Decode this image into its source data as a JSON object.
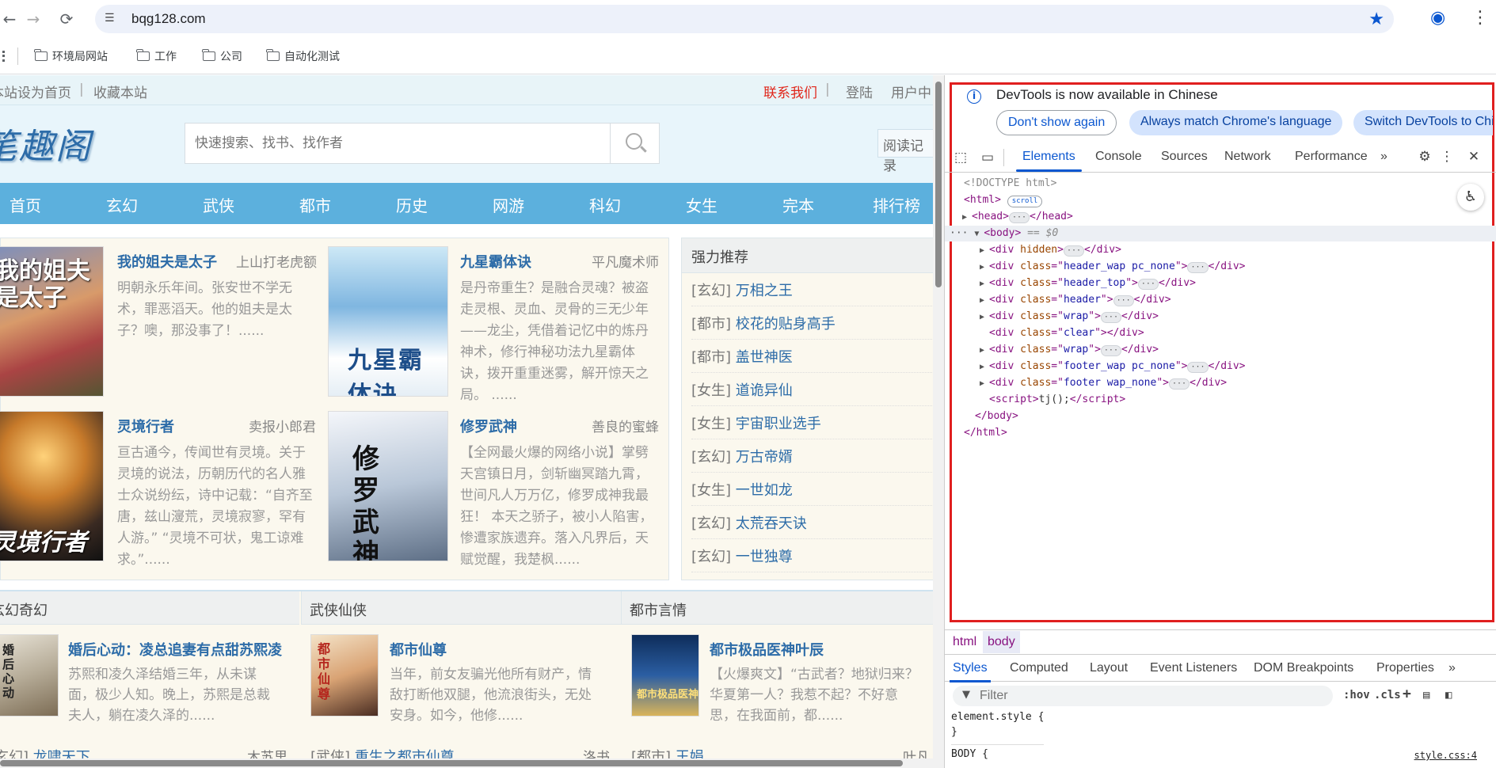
{
  "browser": {
    "url": "bqg128.com",
    "bookmarks": [
      "环境局网站",
      "工作",
      "公司",
      "自动化测试"
    ]
  },
  "site": {
    "topbar": {
      "set_home": "本站设为首页",
      "separator": "|",
      "bookmark_site": "收藏本站",
      "contact": "联系我们",
      "login": "登陆",
      "user_center": "用户中"
    },
    "logo_text": "笔趣阁",
    "search_placeholder": "快速搜索、找书、找作者",
    "reading_history": "阅读记录",
    "menu": [
      "首页",
      "玄幻",
      "武侠",
      "都市",
      "历史",
      "网游",
      "科幻",
      "女生",
      "完本",
      "排行榜"
    ],
    "hot_books": [
      {
        "title": "我的姐夫是太子",
        "author": "上山打老虎额",
        "desc": "明朝永乐年间。张安世不学无术，罪恶滔天。他的姐夫是太子？噢，那没事了！......",
        "cover_text": "我的姐夫是太子"
      },
      {
        "title": "九星霸体诀",
        "author": "平凡魔术师",
        "desc": "是丹帝重生？是融合灵魂？被盗走灵根、灵血、灵骨的三无少年——龙尘，凭借着记忆中的炼丹神术，修行神秘功法九星霸体诀，拨开重重迷雾，解开惊天之局。 ......",
        "cover_text": "九星霸体诀"
      },
      {
        "title": "灵境行者",
        "author": "卖报小郎君",
        "desc": "亘古通今，传闻世有灵境。关于灵境的说法，历朝历代的名人雅士众说纷纭，诗中记载：“自齐至唐，兹山濅荒，灵境寂寥，罕有人游。” “灵境不可状，鬼工谅难求。”......",
        "cover_text": "灵境行者"
      },
      {
        "title": "修罗武神",
        "author": "善良的蜜蜂",
        "desc": "【全网最火爆的网络小说】掌劈天宫镇日月，剑斩幽冥踏九霄，世间凡人万万亿，修罗成神我最狂！ 本天之骄子，被小人陷害，惨遭家族遗弃。落入凡界后，天赋觉醒，我楚枫......",
        "cover_text": "修罗武神"
      }
    ],
    "recommend": {
      "heading": "强力推荐",
      "items": [
        {
          "cat": "[玄幻]",
          "title": "万相之王"
        },
        {
          "cat": "[都市]",
          "title": "校花的贴身高手"
        },
        {
          "cat": "[都市]",
          "title": "盖世神医"
        },
        {
          "cat": "[女生]",
          "title": "道诡异仙"
        },
        {
          "cat": "[女生]",
          "title": "宇宙职业选手"
        },
        {
          "cat": "[玄幻]",
          "title": "万古帝婿"
        },
        {
          "cat": "[女生]",
          "title": "一世如龙"
        },
        {
          "cat": "[玄幻]",
          "title": "太荒吞天诀"
        },
        {
          "cat": "[玄幻]",
          "title": "一世独尊"
        }
      ]
    },
    "sections": [
      {
        "heading": "玄幻奇幻",
        "featured_title": "婚后心动：凌总追妻有点甜苏熙凌",
        "featured_desc": "苏熙和凌久泽结婚三年，从未谋面，极少人知。晚上，苏熙是总裁夫人，躺在凌久泽的......",
        "cover_text": "婚后心动",
        "line_cat": "[玄幻]",
        "line_title": "龙啸天下",
        "line_author": "木苏里"
      },
      {
        "heading": "武侠仙侠",
        "featured_title": "都市仙尊",
        "featured_desc": "当年，前女友骗光他所有财产，情敌打断他双腿，他流浪街头，无处安身。如今，他修......",
        "cover_text": "都市仙尊",
        "line_cat": "[武侠]",
        "line_title": "重生之都市仙尊",
        "line_author": "洛书"
      },
      {
        "heading": "都市言情",
        "featured_title": "都市极品医神叶辰",
        "featured_desc": "【火爆爽文】“古武者？地狱归来？华夏第一人？我惹不起？不好意思，在我面前，都......",
        "cover_text": "都市极品医神",
        "line_cat": "[都市]",
        "line_title": "王娟",
        "line_author": "叶凡"
      }
    ]
  },
  "devtools": {
    "notice": "DevTools is now available in Chinese",
    "btn_dont_show": "Don't show again",
    "btn_match": "Always match Chrome's language",
    "btn_switch": "Switch DevTools to Chi",
    "tabs": [
      "Elements",
      "Console",
      "Sources",
      "Network",
      "Performance"
    ],
    "dom": {
      "doctype": "<!DOCTYPE html>",
      "html_open": "<html>",
      "scroll_pill": "scroll",
      "head": "head",
      "body": "body",
      "body_eq": "== $0",
      "divs": [
        {
          "attr": "hidden",
          "val": ""
        },
        {
          "attr": "class",
          "val": "header_wap pc_none"
        },
        {
          "attr": "class",
          "val": "header_top"
        },
        {
          "attr": "class",
          "val": "header"
        },
        {
          "attr": "class",
          "val": "wrap"
        },
        {
          "attr": "class",
          "val": "clear"
        },
        {
          "attr": "class",
          "val": "wrap"
        },
        {
          "attr": "class",
          "val": "footer_wap pc_none"
        },
        {
          "attr": "class",
          "val": "footer wap_none"
        }
      ],
      "script_text": "tj();",
      "body_close": "</body>",
      "html_close": "</html>"
    },
    "breadcrumbs": [
      "html",
      "body"
    ],
    "style_tabs": [
      "Styles",
      "Computed",
      "Layout",
      "Event Listeners",
      "DOM Breakpoints",
      "Properties"
    ],
    "filter_placeholder": "Filter",
    "filter_tools": [
      ":hov",
      ".cls",
      "+"
    ],
    "styles_lines": [
      "element.style {",
      "}",
      "BODY {"
    ],
    "css_source": "style.css:4"
  }
}
